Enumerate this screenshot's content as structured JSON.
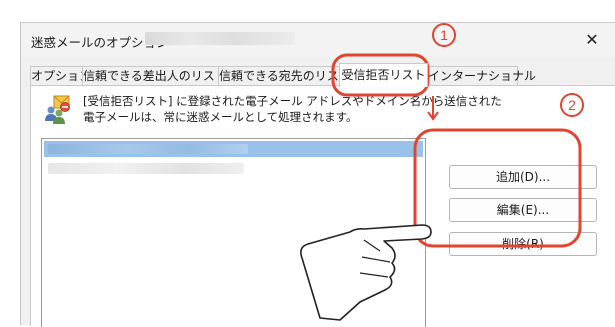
{
  "dialog": {
    "title": "迷惑メールのオプション -",
    "close_symbol": "✕"
  },
  "tabs": [
    {
      "label": "オプション"
    },
    {
      "label": "信頼できる差出人のリスト"
    },
    {
      "label": "信頼できる宛先のリスト"
    },
    {
      "label": "受信拒否リスト",
      "active": true
    },
    {
      "label": "インターナショナル"
    }
  ],
  "panel": {
    "icon": "blocked-senders-icon",
    "description_line1": "[受信拒否リスト] に登録された電子メール アドレスやドメイン名から送信された",
    "description_line2": "電子メールは、常に迷惑メールとして処理されます。"
  },
  "buttons": {
    "add": "追加(D)...",
    "edit": "編集(E)...",
    "delete": "削除(R)"
  },
  "annotations": {
    "step1": "1",
    "step2": "2",
    "highlight_color": "#e0452f"
  }
}
